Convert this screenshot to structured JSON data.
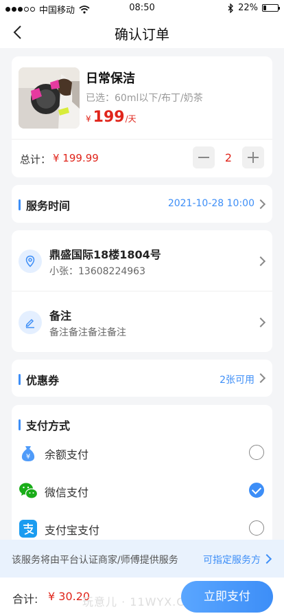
{
  "status_bar": {
    "carrier": "中国移动",
    "time": "08:50",
    "battery": "22%",
    "battery_level": 0.22
  },
  "navbar": {
    "title": "确认订单"
  },
  "product": {
    "name": "日常保洁",
    "spec": "已选：60ml以下/布丁/奶茶",
    "price_symbol": "¥",
    "price": "199",
    "price_unit": "/天",
    "total_label": "总计：",
    "total_value": "¥ 199.99",
    "quantity": "2"
  },
  "service_time": {
    "label": "服务时间",
    "value": "2021-10-28   10:00"
  },
  "address": {
    "title": "鼎盛国际18楼1804号",
    "contact": "小张：13608224963"
  },
  "remark": {
    "title": "备注",
    "content": "备注备注备注备注"
  },
  "coupon": {
    "label": "优惠券",
    "value": "2张可用"
  },
  "payment": {
    "label": "支付方式",
    "methods": [
      {
        "label": "余额支付",
        "icon": "money-bag-icon",
        "selected": false
      },
      {
        "label": "微信支付",
        "icon": "wechat-icon",
        "selected": true
      },
      {
        "label": "支付宝支付",
        "icon": "alipay-icon",
        "selected": false
      }
    ]
  },
  "notice": {
    "text": "该服务将由平台认证商家/师傅提供服务",
    "link": "可指定服务方"
  },
  "footer": {
    "sum_label": "合计:",
    "sum_value": "¥ 30.20",
    "watermark": "玩意儿 · 11WYX.COM",
    "pay_button": "立即支付"
  },
  "colors": {
    "accent": "#3d8ef7",
    "price": "#e0251b",
    "wechat": "#1aad19"
  }
}
